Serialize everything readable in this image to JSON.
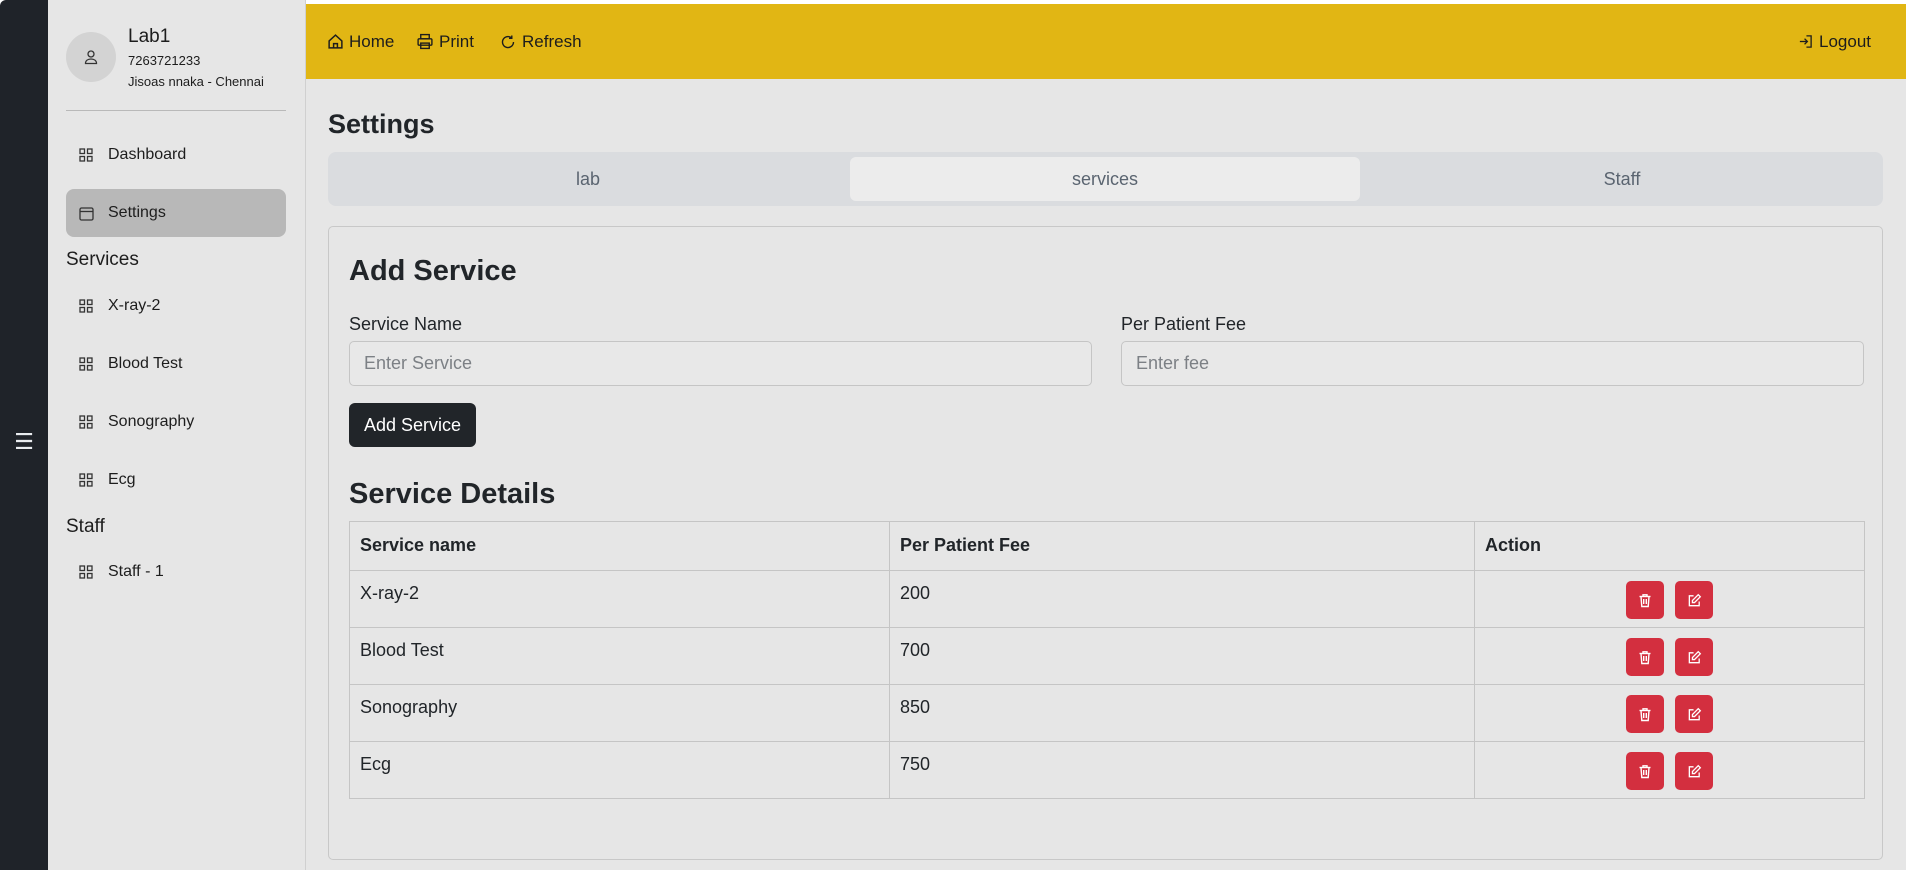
{
  "profile": {
    "name": "Lab1",
    "phone": "7263721233",
    "location": "Jisoas nnaka - Chennai"
  },
  "sidebar": {
    "items": [
      {
        "label": "Dashboard",
        "icon": "grid-icon"
      },
      {
        "label": "Settings",
        "icon": "calendar-icon",
        "active": true
      }
    ],
    "services_label": "Services",
    "services": [
      {
        "label": "X-ray-2",
        "icon": "grid-icon"
      },
      {
        "label": "Blood Test",
        "icon": "grid-icon"
      },
      {
        "label": "Sonography",
        "icon": "grid-icon"
      },
      {
        "label": "Ecg",
        "icon": "grid-icon"
      }
    ],
    "staff_label": "Staff",
    "staff": [
      {
        "label": "Staff - 1",
        "icon": "grid-icon"
      }
    ]
  },
  "topbar": {
    "home": "Home",
    "print": "Print",
    "refresh": "Refresh",
    "logout": "Logout"
  },
  "page": {
    "title": "Settings",
    "tabs": [
      {
        "label": "lab"
      },
      {
        "label": "services",
        "active": true
      },
      {
        "label": "Staff"
      }
    ]
  },
  "form": {
    "title": "Add Service",
    "service_name_label": "Service Name",
    "service_name_placeholder": "Enter Service",
    "fee_label": "Per Patient Fee",
    "fee_placeholder": "Enter fee",
    "submit_label": "Add Service"
  },
  "details": {
    "title": "Service Details",
    "columns": [
      "Service name",
      "Per Patient Fee",
      "Action"
    ],
    "rows": [
      {
        "name": "X-ray-2",
        "fee": "200"
      },
      {
        "name": "Blood Test",
        "fee": "700"
      },
      {
        "name": "Sonography",
        "fee": "850"
      },
      {
        "name": "Ecg",
        "fee": "750"
      }
    ]
  },
  "colors": {
    "topbar": "#e1b614",
    "rail": "#1f2329",
    "danger": "#d32f3f",
    "primary_button": "#212529"
  }
}
